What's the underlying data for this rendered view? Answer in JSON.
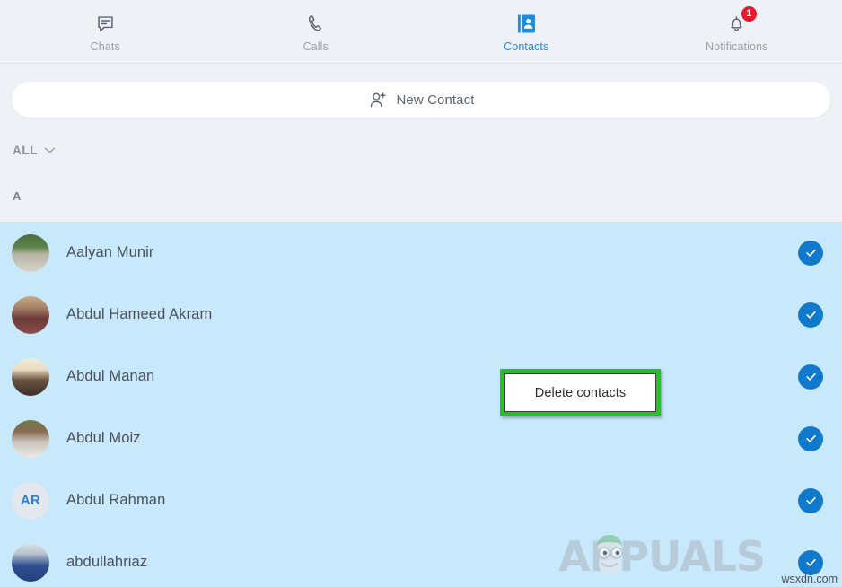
{
  "nav": {
    "items": [
      {
        "label": "Chats",
        "icon": "chat-bubble-icon",
        "active": false,
        "badge": null
      },
      {
        "label": "Calls",
        "icon": "phone-icon",
        "active": false,
        "badge": null
      },
      {
        "label": "Contacts",
        "icon": "contact-book-icon",
        "active": true,
        "badge": null
      },
      {
        "label": "Notifications",
        "icon": "bell-icon",
        "active": false,
        "badge": "1"
      }
    ],
    "active_color": "#1a8fe0",
    "inactive_color": "#9aa1ab",
    "badge_color": "#e8192c"
  },
  "new_contact": {
    "label": "New Contact",
    "icon": "person-plus-icon"
  },
  "filter": {
    "label": "ALL",
    "icon": "chevron-down-icon"
  },
  "section": {
    "letter": "A"
  },
  "contacts": [
    {
      "name": "Aalyan Munir",
      "avatar_type": "photo",
      "initials": "",
      "selected": true
    },
    {
      "name": "Abdul Hameed Akram",
      "avatar_type": "photo",
      "initials": "",
      "selected": true
    },
    {
      "name": "Abdul Manan",
      "avatar_type": "photo",
      "initials": "",
      "selected": true
    },
    {
      "name": "Abdul Moiz",
      "avatar_type": "photo",
      "initials": "",
      "selected": true
    },
    {
      "name": "Abdul Rahman",
      "avatar_type": "initials",
      "initials": "AR",
      "selected": true
    },
    {
      "name": "abdullahriaz",
      "avatar_type": "photo",
      "initials": "",
      "selected": true
    }
  ],
  "tooltip": {
    "label": "Delete contacts",
    "highlight_color": "#22c322"
  },
  "watermark": {
    "brand": "APPUALS",
    "site": "wsxdn.com"
  },
  "colors": {
    "header_bg": "#eef1f6",
    "list_selected_bg": "#c7e9fb",
    "check_blue": "#1179cc"
  }
}
